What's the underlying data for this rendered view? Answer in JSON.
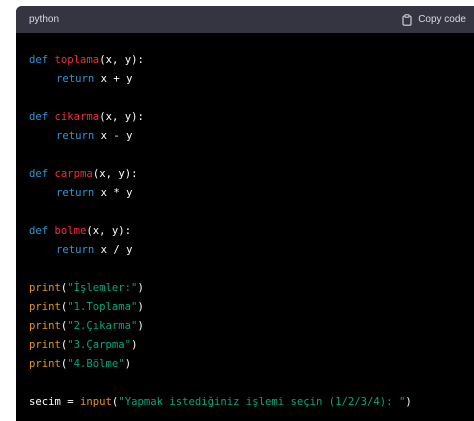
{
  "header": {
    "language_label": "python",
    "copy_label": "Copy code",
    "copy_icon": "clipboard-icon"
  },
  "code_lines": [
    [
      "def",
      "toplama",
      "(x, y):"
    ],
    [
      "return",
      "x + y"
    ],
    [
      "def",
      "cikarma",
      "(x, y):"
    ],
    [
      "return",
      "x - y"
    ],
    [
      "def",
      "carpma",
      "(x, y):"
    ],
    [
      "return",
      "x * y"
    ],
    [
      "def",
      "bolme",
      "(x, y):"
    ],
    [
      "return",
      "x / y"
    ],
    [
      "print",
      "(",
      "\"İşlemler:\"",
      ")"
    ],
    [
      "print",
      "(",
      "\"1.Toplama\"",
      ")"
    ],
    [
      "print",
      "(",
      "\"2.Çıkarma\"",
      ")"
    ],
    [
      "print",
      "(",
      "\"3.Çarpma\"",
      ")"
    ],
    [
      "print",
      "(",
      "\"4.Bölme\"",
      ")"
    ],
    [
      "secim = ",
      "input",
      "(",
      "\"Yapmak istediğiniz işlemi seçin (1/2/3/4): \"",
      ")"
    ]
  ],
  "colors": {
    "keyword": "#2e95d3",
    "function_name": "#f22c3d",
    "builtin": "#e9950c",
    "string": "#00a67d",
    "header_bg": "#343541",
    "code_bg": "#000000"
  }
}
